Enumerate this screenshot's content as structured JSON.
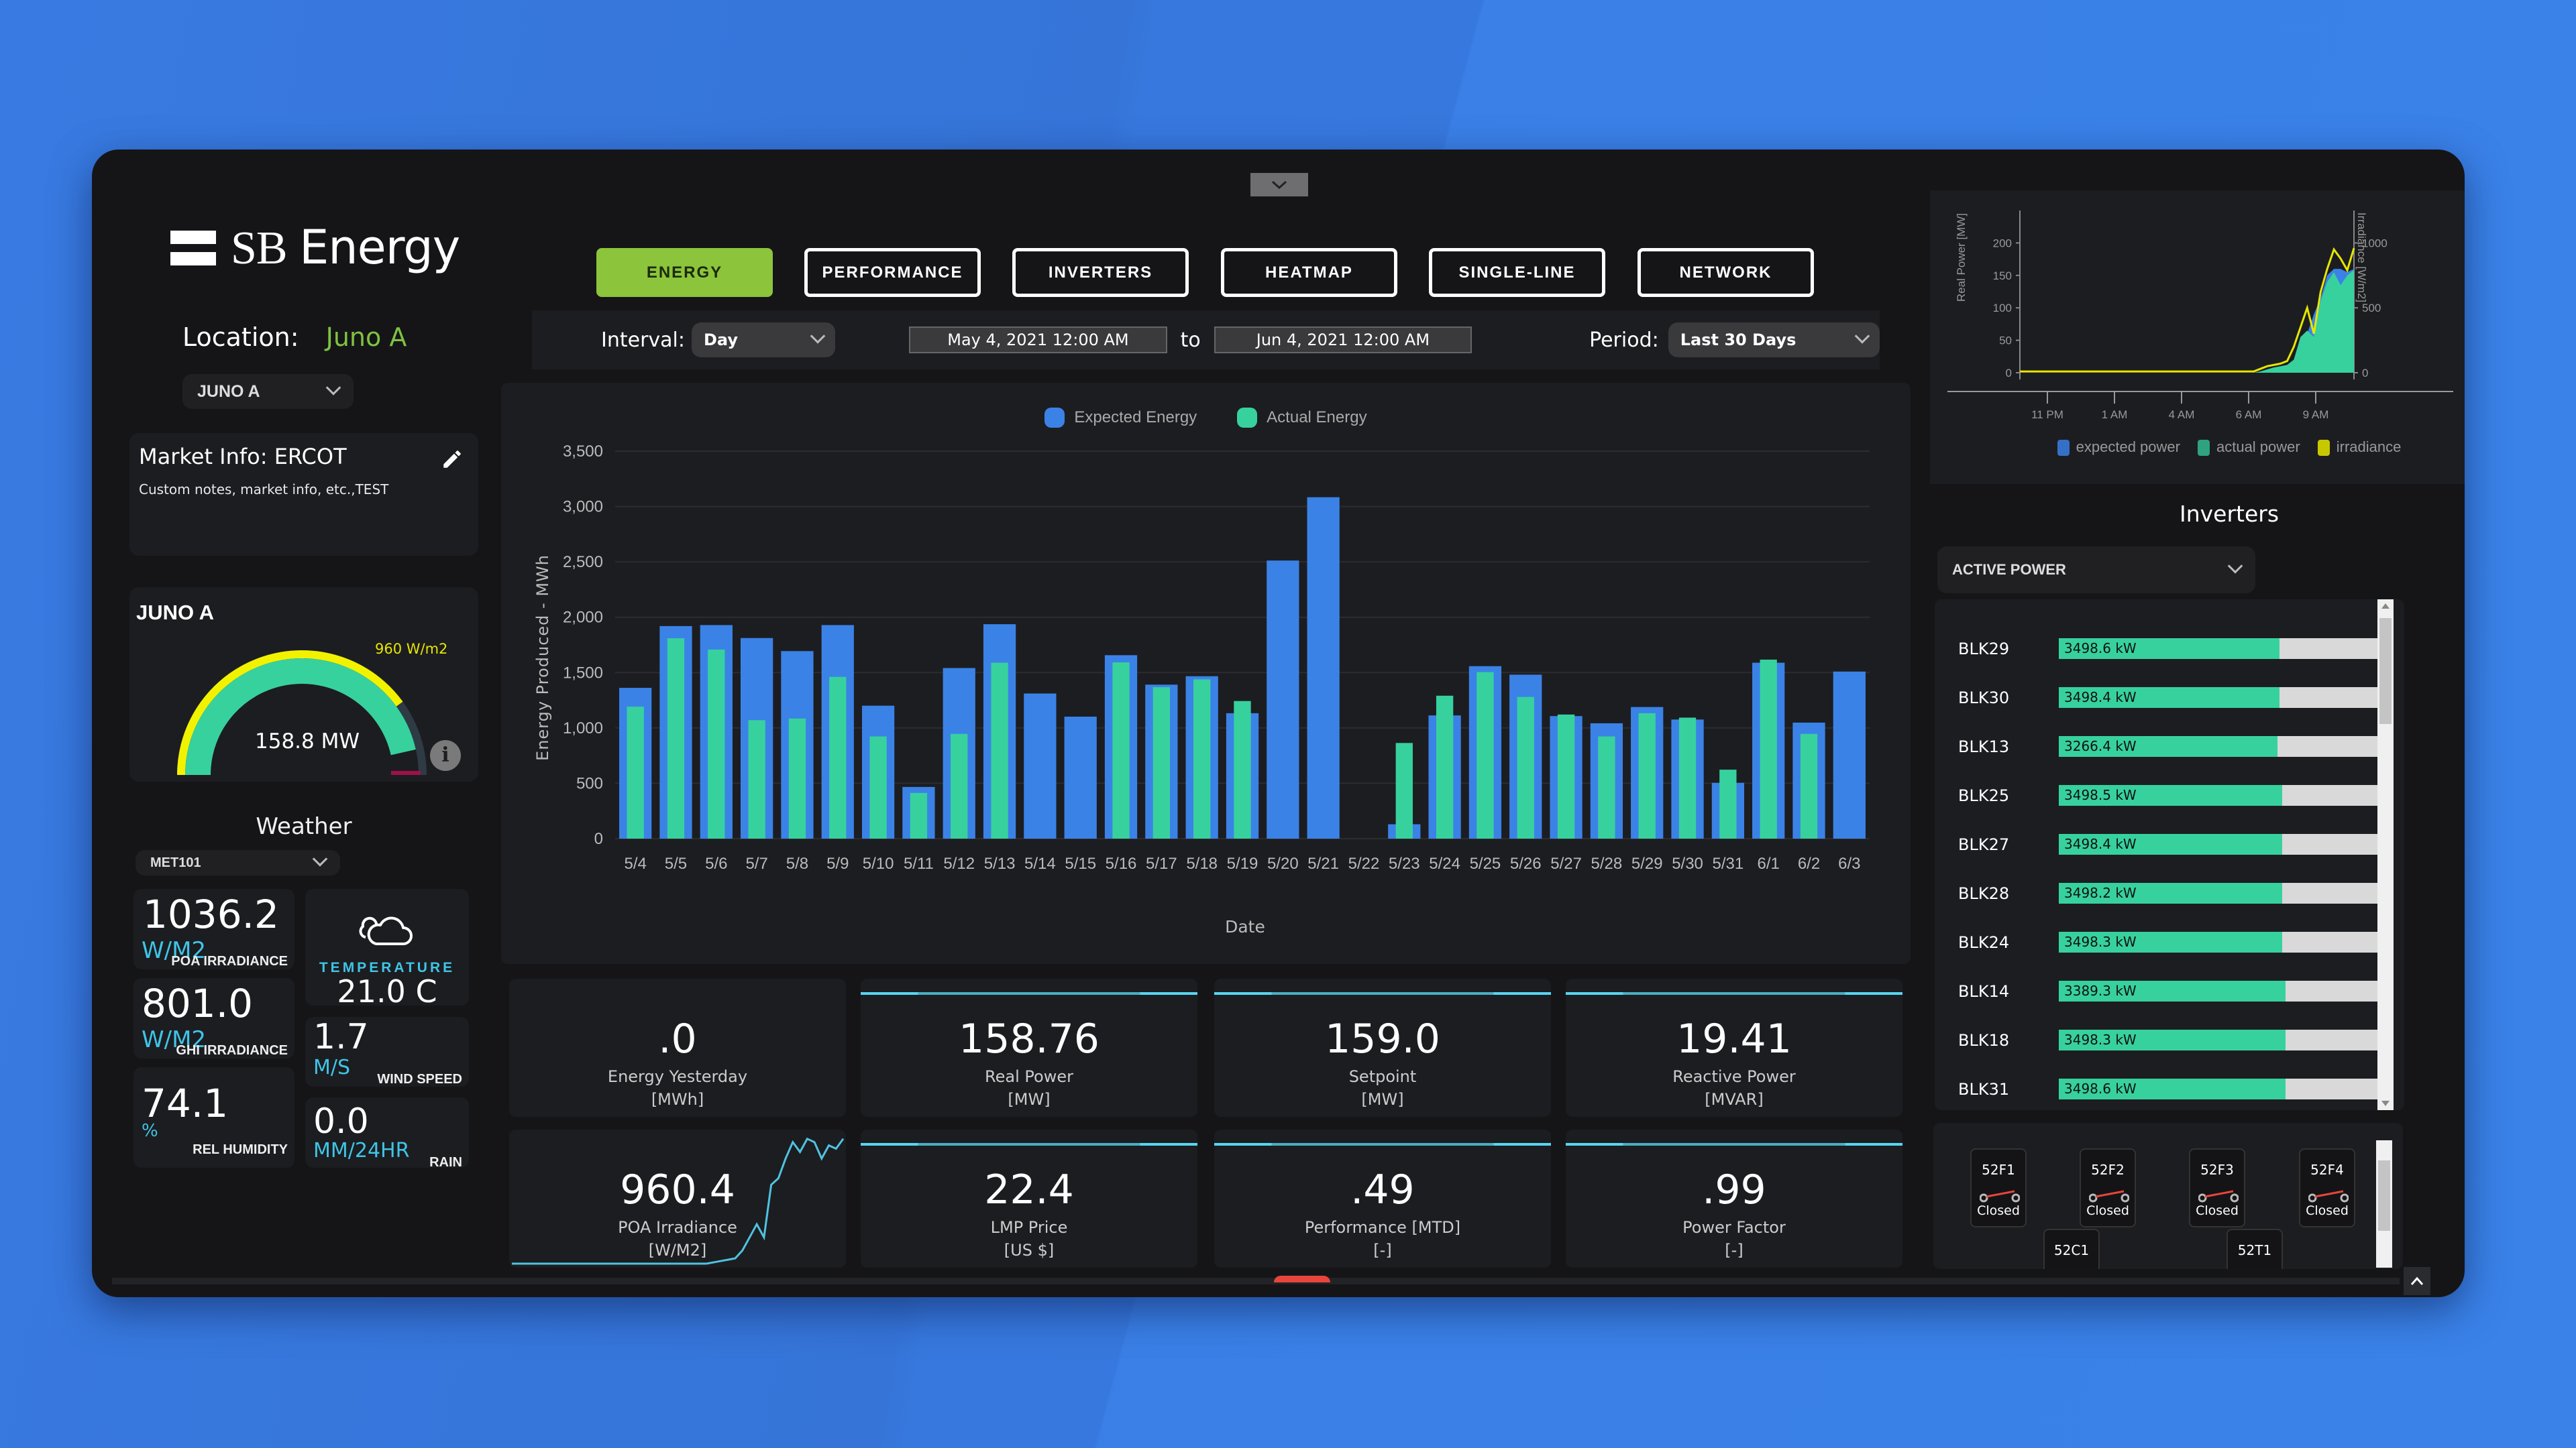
{
  "app": {
    "brand": {
      "part1": "SB",
      "part2": "Energy"
    },
    "location_label": "Location:",
    "location_value": "Juno A",
    "site_select": "JUNO A"
  },
  "market": {
    "title": "Market Info: ERCOT",
    "notes": "Custom notes, market info, etc.,TEST"
  },
  "gauge": {
    "site": "JUNO A",
    "value_label": "158.8 MW",
    "irradiance_label": "960 W/m2",
    "power_fraction": 0.93,
    "irradiance_fraction": 0.8,
    "colors": {
      "power": "#37d19e",
      "irradiance": "#f2f200",
      "track": "#2e3a44",
      "limit": "#a0104a"
    }
  },
  "weather": {
    "title": "Weather",
    "station_select": "MET101",
    "items": [
      {
        "id": "poa",
        "value": "1036.2",
        "unit": "W/M2",
        "label": "POA IRRADIANCE"
      },
      {
        "id": "ghi",
        "value": "801.0",
        "unit": "W/M2",
        "label": "GHI IRRADIANCE"
      },
      {
        "id": "humidity",
        "value": "74.1",
        "unit": "%",
        "label": "REL HUMIDITY"
      },
      {
        "id": "temperature",
        "value": "21.0 C",
        "unit": "",
        "label": "TEMPERATURE",
        "icon": "cloud-icon"
      },
      {
        "id": "wind",
        "value": "1.7",
        "unit": "M/S",
        "label": "WIND SPEED"
      },
      {
        "id": "rain",
        "value": "0.0",
        "unit": "MM/24HR",
        "label": "RAIN"
      }
    ]
  },
  "tabs": [
    {
      "label": "ENERGY",
      "active": true
    },
    {
      "label": "PERFORMANCE",
      "active": false
    },
    {
      "label": "INVERTERS",
      "active": false
    },
    {
      "label": "HEATMAP",
      "active": false
    },
    {
      "label": "SINGLE-LINE",
      "active": false
    },
    {
      "label": "NETWORK",
      "active": false
    }
  ],
  "filters": {
    "interval_label": "Interval:",
    "interval_value": "Day",
    "start_date": "May 4, 2021 12:00 AM",
    "to_label": "to",
    "end_date": "Jun 4, 2021 12:00 AM",
    "period_label": "Period:",
    "period_value": "Last 30 Days"
  },
  "chart_data": [
    {
      "type": "bar",
      "title": "",
      "xlabel": "Date",
      "ylabel": "Energy Produced - MWh",
      "ylim": [
        0,
        3500
      ],
      "yticks": [
        0,
        500,
        1000,
        1500,
        2000,
        2500,
        3000,
        3500
      ],
      "ytick_labels": [
        "0",
        "500",
        "1,000",
        "1,500",
        "2,000",
        "2,500",
        "3,000",
        "3,500"
      ],
      "grid": true,
      "legend_position": "top-center",
      "categories": [
        "5/4",
        "5/5",
        "5/6",
        "5/7",
        "5/8",
        "5/9",
        "5/10",
        "5/11",
        "5/12",
        "5/13",
        "5/14",
        "5/15",
        "5/16",
        "5/17",
        "5/18",
        "5/19",
        "5/20",
        "5/21",
        "5/22",
        "5/23",
        "5/24",
        "5/25",
        "5/26",
        "5/27",
        "5/28",
        "5/29",
        "5/30",
        "5/31",
        "6/1",
        "6/2",
        "6/3"
      ],
      "series": [
        {
          "name": "Expected Energy",
          "color": "#3b82e6",
          "values": [
            1362,
            1920,
            1929,
            1812,
            1694,
            1929,
            1201,
            467,
            1541,
            1937,
            1311,
            1102,
            1657,
            1391,
            1467,
            1133,
            2512,
            3084,
            0,
            130,
            1113,
            1558,
            1481,
            1107,
            1042,
            1189,
            1076,
            504,
            1589,
            1048,
            1509
          ]
        },
        {
          "name": "Actual Energy",
          "color": "#37d19e",
          "values": [
            1192,
            1810,
            1708,
            1070,
            1085,
            1461,
            923,
            413,
            946,
            1589,
            0,
            0,
            1592,
            1368,
            1439,
            1243,
            0,
            0,
            0,
            864,
            1291,
            1504,
            1280,
            1121,
            923,
            1133,
            1093,
            623,
            1617,
            946,
            0
          ]
        }
      ]
    },
    {
      "type": "area",
      "title": "",
      "xlabel": "",
      "ylabel": "Real Power [MW]",
      "y2label": "Irradiance [W/m2]",
      "ylim": [
        0,
        250
      ],
      "y2lim": [
        0,
        1250
      ],
      "yticks": [
        0,
        50,
        100,
        150,
        200
      ],
      "y2ticks": [
        0,
        500,
        1000
      ],
      "xtick_labels": [
        "11 PM",
        "1 AM",
        "4 AM",
        "6 AM",
        "9 AM"
      ],
      "legend_position": "bottom",
      "x": [
        0,
        1,
        2,
        3,
        4,
        5,
        6,
        7,
        8,
        9,
        10,
        11,
        12,
        13,
        14,
        15,
        16,
        17,
        18,
        19,
        20,
        21,
        22,
        23,
        24,
        25,
        26,
        27,
        28,
        29,
        30,
        31,
        32,
        33,
        34,
        35,
        36,
        37,
        38,
        39,
        40,
        41,
        42,
        43,
        44,
        45,
        46,
        47,
        48,
        49,
        50
      ],
      "series": [
        {
          "name": "expected power",
          "color": "#3570c8",
          "values": [
            0,
            0,
            0,
            0,
            0,
            0,
            0,
            0,
            0,
            0,
            0,
            0,
            0,
            0,
            0,
            0,
            0,
            0,
            0,
            0,
            0,
            0,
            0,
            0,
            0,
            0,
            0,
            0,
            0,
            0,
            0,
            0,
            0,
            0,
            0,
            0,
            2,
            5,
            8,
            10,
            12,
            20,
            50,
            60,
            90,
            115,
            150,
            160,
            160,
            155,
            160
          ]
        },
        {
          "name": "actual power",
          "color": "#2ea37e",
          "values": [
            0,
            0,
            0,
            0,
            0,
            0,
            0,
            0,
            0,
            0,
            0,
            0,
            0,
            0,
            0,
            0,
            0,
            0,
            0,
            0,
            0,
            0,
            0,
            0,
            0,
            0,
            0,
            0,
            0,
            0,
            0,
            0,
            0,
            0,
            0,
            0,
            2,
            5,
            8,
            10,
            12,
            20,
            55,
            65,
            55,
            110,
            140,
            155,
            135,
            150,
            158
          ]
        },
        {
          "name": "irradiance",
          "color": "#c8c800",
          "values": [
            10,
            10,
            10,
            10,
            10,
            10,
            10,
            10,
            10,
            10,
            10,
            10,
            10,
            10,
            10,
            10,
            10,
            10,
            10,
            10,
            10,
            10,
            10,
            10,
            10,
            10,
            10,
            10,
            10,
            10,
            10,
            10,
            10,
            10,
            10,
            10,
            30,
            50,
            60,
            70,
            90,
            200,
            350,
            500,
            300,
            620,
            800,
            950,
            880,
            790,
            960
          ]
        }
      ]
    }
  ],
  "kpis": [
    {
      "value": ".0",
      "label": "Energy Yesterday",
      "unit": "[MWh]",
      "topline": false
    },
    {
      "value": "158.76",
      "label": "Real Power",
      "unit": "[MW]",
      "topline": true
    },
    {
      "value": "159.0",
      "label": "Setpoint",
      "unit": "[MW]",
      "topline": true
    },
    {
      "value": "19.41",
      "label": "Reactive Power",
      "unit": "[MVAR]",
      "topline": true
    },
    {
      "value": "960.4",
      "label": "POA Irradiance",
      "unit": "[W/M2]",
      "topline": false,
      "sparkline": true
    },
    {
      "value": "22.4",
      "label": "LMP Price",
      "unit": "[US $]",
      "topline": true
    },
    {
      "value": ".49",
      "label": "Performance [MTD]",
      "unit": "[-]",
      "topline": true
    },
    {
      "value": ".99",
      "label": "Power Factor",
      "unit": "[-]",
      "topline": true
    }
  ],
  "poa_sparkline": [
    0,
    0,
    0,
    0,
    0,
    0,
    0,
    0,
    0,
    0,
    0,
    0,
    0,
    0,
    0,
    0,
    0,
    0,
    0,
    0,
    0,
    0,
    0,
    0,
    0,
    0,
    0,
    0,
    2,
    4,
    6,
    8,
    20,
    40,
    60,
    40,
    120,
    130,
    160,
    185,
    170,
    190,
    185,
    160,
    180,
    175,
    190
  ],
  "inverters": {
    "title": "Inverters",
    "metric_select": "ACTIVE POWER",
    "items": [
      {
        "name": "BLK29",
        "value": "3498.6 kW",
        "fraction": 0.69
      },
      {
        "name": "BLK30",
        "value": "3498.4 kW",
        "fraction": 0.69
      },
      {
        "name": "BLK13",
        "value": "3266.4 kW",
        "fraction": 0.683
      },
      {
        "name": "BLK25",
        "value": "3498.5 kW",
        "fraction": 0.698
      },
      {
        "name": "BLK27",
        "value": "3498.4 kW",
        "fraction": 0.698
      },
      {
        "name": "BLK28",
        "value": "3498.2 kW",
        "fraction": 0.698
      },
      {
        "name": "BLK24",
        "value": "3498.3 kW",
        "fraction": 0.698
      },
      {
        "name": "BLK14",
        "value": "3389.3 kW",
        "fraction": 0.708
      },
      {
        "name": "BLK18",
        "value": "3498.3 kW",
        "fraction": 0.708
      },
      {
        "name": "BLK31",
        "value": "3498.6 kW",
        "fraction": 0.708
      }
    ]
  },
  "breakers": [
    {
      "name": "52F1",
      "status": "Closed"
    },
    {
      "name": "52F2",
      "status": "Closed"
    },
    {
      "name": "52F3",
      "status": "Closed"
    },
    {
      "name": "52F4",
      "status": "Closed"
    },
    {
      "name": "52C1",
      "status": ""
    },
    {
      "name": "52T1",
      "status": ""
    }
  ]
}
